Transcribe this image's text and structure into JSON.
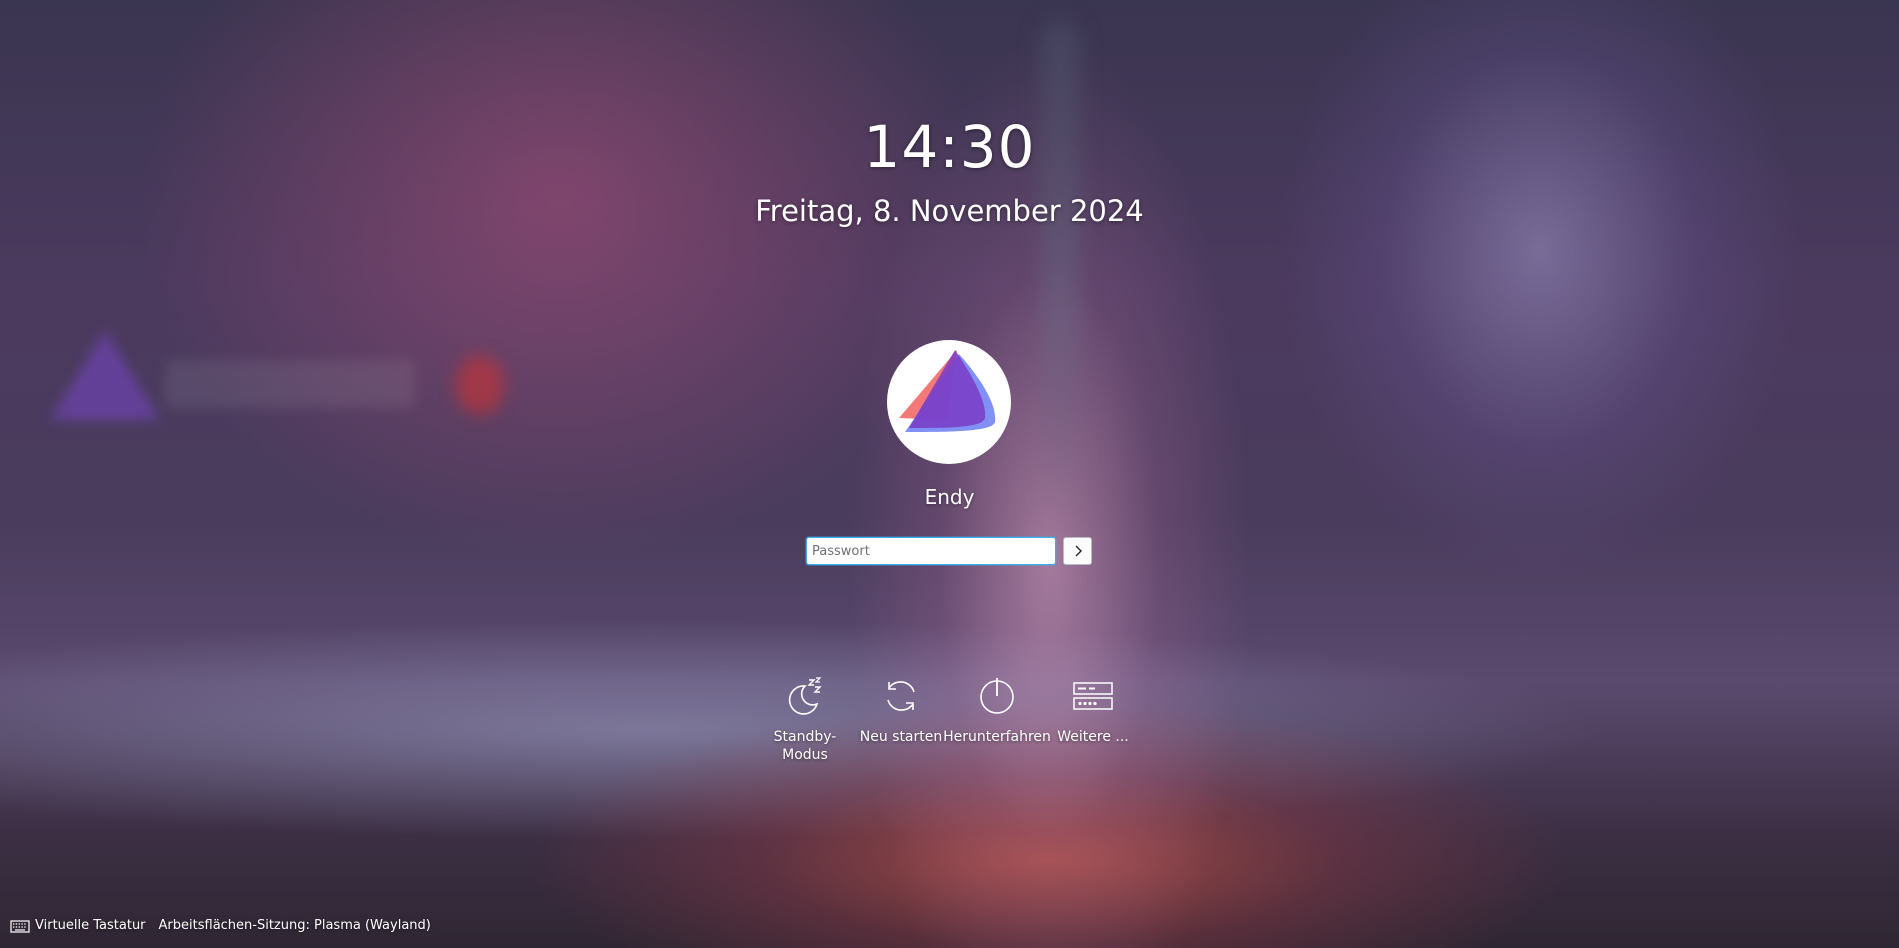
{
  "lockscreen": {
    "time": "14:30",
    "date": "Freitag, 8. November 2024"
  },
  "user": {
    "name": "Endy",
    "avatar_icon": "triangle-logo-icon"
  },
  "login": {
    "password_placeholder": "Passwort",
    "password_value": "",
    "submit_icon": "chevron-right-icon"
  },
  "actions": [
    {
      "label": "Standby-Modus",
      "icon": "sleep-moon-icon"
    },
    {
      "label": "Neu starten",
      "icon": "restart-icon"
    },
    {
      "label": "Herunterfahren",
      "icon": "power-icon"
    },
    {
      "label": "Weitere ...",
      "icon": "switch-session-icon"
    }
  ],
  "bottom": {
    "virtual_keyboard": "Virtuelle Tastatur",
    "session": "Arbeitsflächen-Sitzung: Plasma (Wayland)"
  },
  "colors": {
    "accent": "#3daee9",
    "avatar_purple": "#7a3bc4",
    "avatar_salmon": "#f26a6a",
    "avatar_blue": "#6b7cf2"
  }
}
